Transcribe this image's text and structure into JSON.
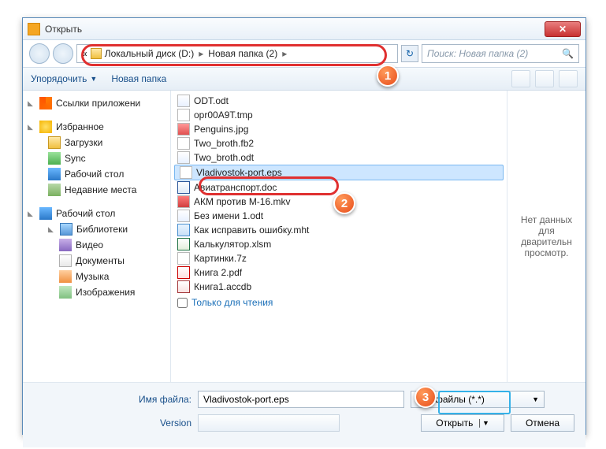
{
  "window": {
    "title": "Открыть"
  },
  "nav": {
    "breadcrumb_prefix": "«",
    "crumb1": "Локальный диск (D:)",
    "crumb2": "Новая папка (2)",
    "search_placeholder": "Поиск: Новая папка (2)",
    "refresh_glyph": "↻"
  },
  "toolbar": {
    "organize": "Упорядочить",
    "newfolder": "Новая папка"
  },
  "sidebar": {
    "app_links": "Ссылки приложени",
    "favorites": "Избранное",
    "downloads": "Загрузки",
    "sync": "Sync",
    "desktop": "Рабочий стол",
    "recent": "Недавние места",
    "desktop2": "Рабочий стол",
    "libraries": "Библиотеки",
    "videos": "Видео",
    "documents": "Документы",
    "music": "Музыка",
    "images": "Изображения"
  },
  "files": [
    {
      "name": "ODT.odt",
      "cls": "odt"
    },
    {
      "name": "opr00A9T.tmp",
      "cls": "tmp"
    },
    {
      "name": "Penguins.jpg",
      "cls": "jpg"
    },
    {
      "name": "Two_broth.fb2",
      "cls": "fb2"
    },
    {
      "name": "Two_broth.odt",
      "cls": "odt"
    },
    {
      "name": "Vladivostok-port.eps",
      "cls": "eps",
      "selected": true
    },
    {
      "name": "Авиатранспорт.doc",
      "cls": "docx"
    },
    {
      "name": "АКМ против М-16.mkv",
      "cls": "mkv"
    },
    {
      "name": "Без имени 1.odt",
      "cls": "odt"
    },
    {
      "name": "Как исправить ошибку.mht",
      "cls": "mht"
    },
    {
      "name": "Калькулятор.xlsm",
      "cls": "xlsm"
    },
    {
      "name": "Картинки.7z",
      "cls": "7z"
    },
    {
      "name": "Книга 2.pdf",
      "cls": "pdf"
    },
    {
      "name": "Книга1.accdb",
      "cls": "accdb"
    }
  ],
  "readonly_label": "Только для чтения",
  "preview_text": "Нет данных для дварительн просмотр.",
  "bottom": {
    "filename_label": "Имя файла:",
    "filename_value": "Vladivostok-port.eps",
    "filetype": "Все файлы (*.*)",
    "version_label": "Version",
    "open": "Открыть",
    "cancel": "Отмена"
  },
  "callouts": {
    "c1": "1",
    "c2": "2",
    "c3": "3"
  }
}
